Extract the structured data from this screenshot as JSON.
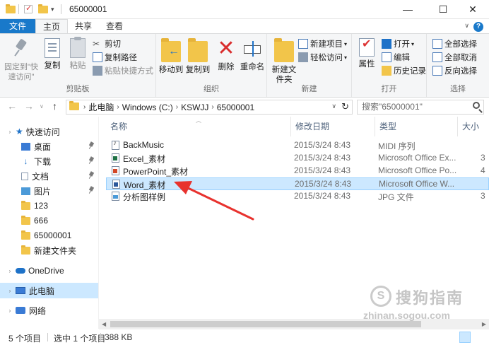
{
  "window": {
    "title": "65000001",
    "minimize_glyph": "—",
    "maximize_glyph": "☐",
    "close_glyph": "✕"
  },
  "ribbon_tabs": [
    "文件",
    "主页",
    "共享",
    "查看"
  ],
  "ribbon": {
    "clipboard": {
      "label": "剪贴板",
      "pin_quick_access": "固定到\"快速访问\"",
      "copy": "复制",
      "paste": "粘贴",
      "cut": "剪切",
      "copy_path": "复制路径",
      "paste_shortcut": "粘贴快捷方式"
    },
    "organize": {
      "label": "组织",
      "move_to": "移动到",
      "copy_to": "复制到",
      "delete": "删除",
      "rename": "重命名"
    },
    "new": {
      "label": "新建",
      "new_folder": "新建文件夹",
      "new_item": "新建项目",
      "easy_access": "轻松访问"
    },
    "open": {
      "label": "打开",
      "properties": "属性",
      "open": "打开",
      "edit": "编辑",
      "history": "历史记录"
    },
    "select": {
      "label": "选择",
      "select_all": "全部选择",
      "select_none": "全部取消",
      "invert": "反向选择"
    }
  },
  "address": {
    "crumbs": [
      "此电脑",
      "Windows (C:)",
      "KSWJJ",
      "65000001"
    ],
    "search_placeholder": "搜索\"65000001\""
  },
  "nav_pane": {
    "quick_access": "快速访问",
    "items": [
      "桌面",
      "下载",
      "文档",
      "图片",
      "123",
      "666",
      "65000001",
      "新建文件夹"
    ],
    "onedrive": "OneDrive",
    "this_pc": "此电脑",
    "network": "网络"
  },
  "columns": [
    "名称",
    "修改日期",
    "类型",
    "大小"
  ],
  "files": [
    {
      "name": "BackMusic",
      "date": "2015/3/24 8:43",
      "type": "MIDI 序列",
      "size": "",
      "icon": "midi-icon"
    },
    {
      "name": "Excel_素材",
      "date": "2015/3/24 8:43",
      "type": "Microsoft Office Ex...",
      "size": "3",
      "icon": "excel-icon"
    },
    {
      "name": "PowerPoint_素材",
      "date": "2015/3/24 8:43",
      "type": "Microsoft Office Po...",
      "size": "4",
      "icon": "powerpoint-icon"
    },
    {
      "name": "Word_素材",
      "date": "2015/3/24 8:43",
      "type": "Microsoft Office W...",
      "size": "",
      "icon": "word-icon"
    },
    {
      "name": "分析图样例",
      "date": "2015/3/24 8:43",
      "type": "JPG 文件",
      "size": "3",
      "icon": "jpg-icon"
    }
  ],
  "status": {
    "count": "5 个项目",
    "selected": "选中 1 个项目",
    "size": "388 KB"
  },
  "watermark": {
    "logo_glyph": "S",
    "brand": "搜狗指南",
    "url": "zhinan.sogou.com"
  },
  "colors": {
    "accent": "#1979ca",
    "selection": "#cce8ff",
    "annotation_arrow": "#e8322e"
  }
}
